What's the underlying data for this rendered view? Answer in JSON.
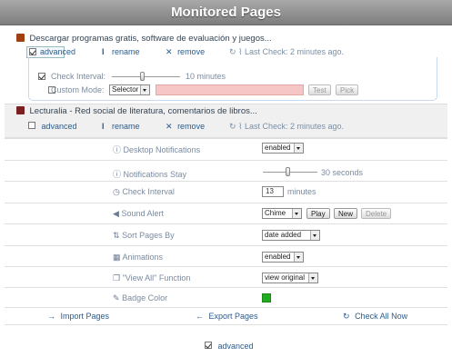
{
  "header": {
    "title": "Monitored Pages"
  },
  "pages": [
    {
      "title": "Descargar programas gratis, software de evaluación y juegos...",
      "advanced_label": "advanced",
      "rename_label": "rename",
      "remove_label": "remove",
      "last_check": "Last Check: 2 minutes ago.",
      "check_interval_label": "Check Interval:",
      "check_interval_value": "10 minutes",
      "custom_mode_label": "Custom Mode:",
      "selector_option": "Selector",
      "test_label": "Test",
      "pick_label": "Pick"
    },
    {
      "title": "Lecturalia - Red social de literatura, comentarios de libros...",
      "advanced_label": "advanced",
      "rename_label": "rename",
      "remove_label": "remove",
      "last_check": "Last Check: 2 minutes ago."
    }
  ],
  "settings": {
    "desktop_notifications": {
      "label": "Desktop Notifications",
      "value": "enabled"
    },
    "notifications_stay": {
      "label": "Notifications Stay",
      "value": "30 seconds"
    },
    "check_interval": {
      "label": "Check Interval",
      "value": "13",
      "unit": "minutes"
    },
    "sound_alert": {
      "label": "Sound Alert",
      "value": "Chime",
      "play": "Play",
      "new": "New",
      "delete": "Delete"
    },
    "sort_pages_by": {
      "label": "Sort Pages By",
      "value": "date added"
    },
    "animations": {
      "label": "Animations",
      "value": "enabled"
    },
    "view_all": {
      "label": "\"View All\" Function",
      "value": "view original"
    },
    "badge_color": {
      "label": "Badge Color",
      "color": "#22aa22"
    }
  },
  "actions": {
    "import": "Import Pages",
    "export": "Export Pages",
    "check_all": "Check All Now"
  },
  "footer": {
    "advanced_label": "advanced"
  },
  "colors": {
    "accent": "#2a5c8f",
    "highlight_input": "#f6c6c6"
  }
}
